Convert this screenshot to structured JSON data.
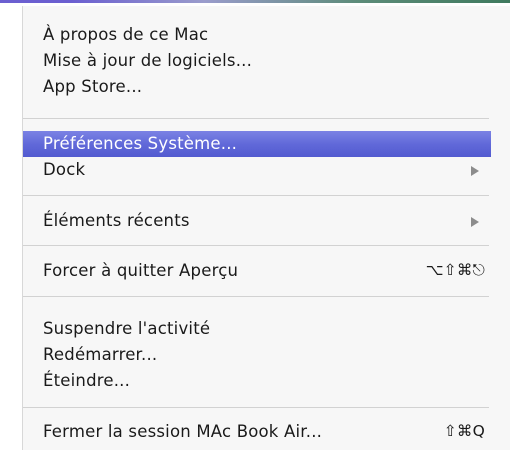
{
  "menu": {
    "items": [
      {
        "label": "À propos de ce Mac"
      },
      {
        "label": "Mise à jour de logiciels..."
      },
      {
        "label": "App Store..."
      },
      {
        "label": "Préférences Système..."
      },
      {
        "label": "Dock"
      },
      {
        "label": "Éléments récents"
      },
      {
        "label": "Forcer à quitter Aperçu",
        "shortcut": "⌥⇧⌘⎋"
      },
      {
        "label": "Suspendre l'activité"
      },
      {
        "label": "Redémarrer..."
      },
      {
        "label": "Éteindre..."
      },
      {
        "label": "Fermer la session MAc Book Air...",
        "shortcut": "⇧⌘Q"
      }
    ]
  },
  "colors": {
    "highlight": "#5f67d8",
    "menu_background": "#f7f7f7",
    "submenu_arrow": "#8c8c8c"
  }
}
